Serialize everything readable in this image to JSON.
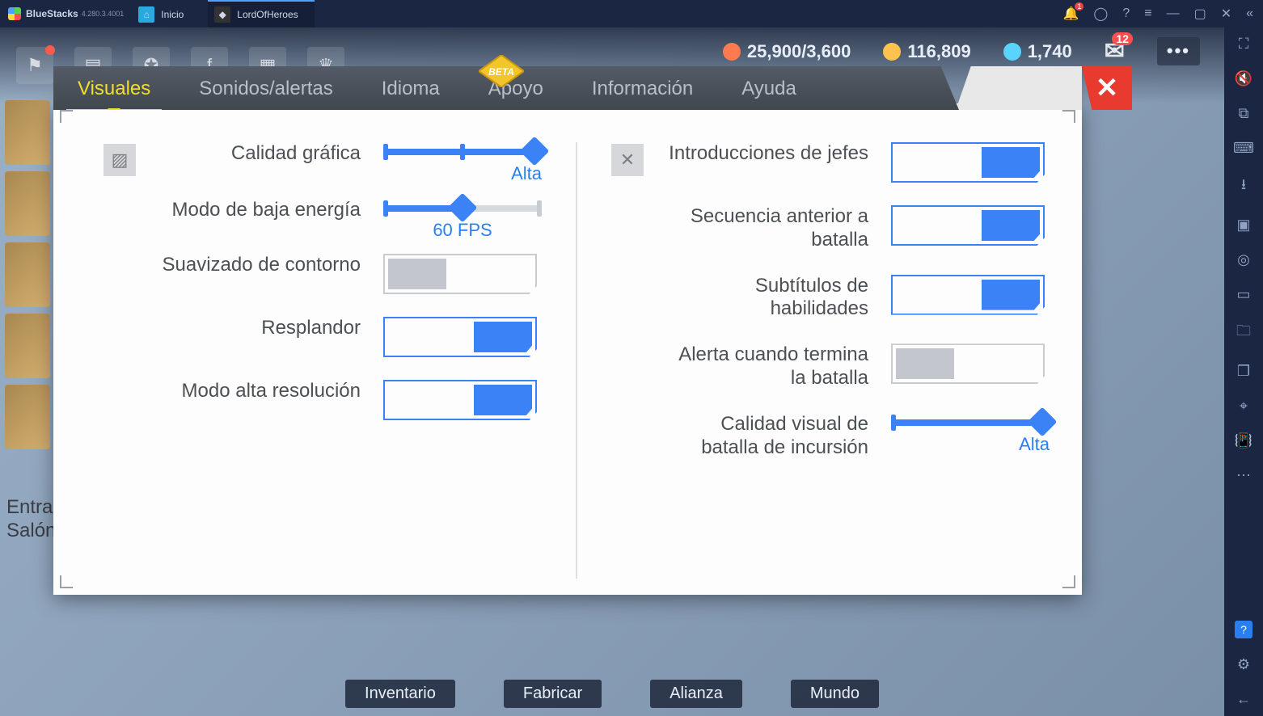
{
  "app": {
    "name": "BlueStacks",
    "version": "4.280.3.4001",
    "tabs": [
      {
        "label": "Inicio"
      },
      {
        "label": "LordOfHeroes"
      }
    ],
    "notifications_badge": "1"
  },
  "hud": {
    "energy": "25,900/3,600",
    "gold": "116,809",
    "gems": "1,740",
    "mail_badge": "12"
  },
  "bg": {
    "entry": "Entra\nSalón",
    "bottom": {
      "inventory": "Inventario",
      "craft": "Fabricar",
      "alliance": "Alianza",
      "world": "Mundo"
    }
  },
  "settings": {
    "badge": "BETA",
    "tabs": {
      "visuals": "Visuales",
      "sounds": "Sonidos/alertas",
      "language": "Idioma",
      "support": "Apoyo",
      "info": "Información",
      "help": "Ayuda"
    },
    "left": {
      "graphics_quality": {
        "label": "Calidad gráfica",
        "value": "Alta"
      },
      "low_power": {
        "label": "Modo de baja energía",
        "value": "60 FPS"
      },
      "anti_aliasing": {
        "label": "Suavizado de contorno"
      },
      "bloom": {
        "label": "Resplandor"
      },
      "high_res": {
        "label": "Modo alta resolución"
      }
    },
    "right": {
      "boss_intros": {
        "label": "Introducciones de jefes"
      },
      "prebattle": {
        "label": "Secuencia anterior a batalla"
      },
      "skill_subs": {
        "label": "Subtítulos de habilidades"
      },
      "battle_end_alert": {
        "label": "Alerta cuando termina la batalla"
      },
      "raid_quality": {
        "label": "Calidad visual de batalla de incursión",
        "value": "Alta"
      }
    }
  },
  "chart_data": {
    "type": "table",
    "title": "Visuales settings",
    "rows": [
      {
        "section": "left",
        "key": "graphics_quality",
        "label": "Calidad gráfica",
        "control": "slider",
        "value": "Alta",
        "position": 1.0
      },
      {
        "section": "left",
        "key": "low_power",
        "label": "Modo de baja energía",
        "control": "slider",
        "value": "60 FPS",
        "position": 0.5
      },
      {
        "section": "left",
        "key": "anti_aliasing",
        "label": "Suavizado de contorno",
        "control": "toggle",
        "value": false
      },
      {
        "section": "left",
        "key": "bloom",
        "label": "Resplandor",
        "control": "toggle",
        "value": true
      },
      {
        "section": "left",
        "key": "high_res",
        "label": "Modo alta resolución",
        "control": "toggle",
        "value": true
      },
      {
        "section": "right",
        "key": "boss_intros",
        "label": "Introducciones de jefes",
        "control": "toggle",
        "value": true
      },
      {
        "section": "right",
        "key": "prebattle",
        "label": "Secuencia anterior a batalla",
        "control": "toggle",
        "value": true
      },
      {
        "section": "right",
        "key": "skill_subs",
        "label": "Subtítulos de habilidades",
        "control": "toggle",
        "value": true
      },
      {
        "section": "right",
        "key": "battle_end_alert",
        "label": "Alerta cuando termina la batalla",
        "control": "toggle",
        "value": false
      },
      {
        "section": "right",
        "key": "raid_quality",
        "label": "Calidad visual de batalla de incursión",
        "control": "slider",
        "value": "Alta",
        "position": 1.0
      }
    ]
  }
}
